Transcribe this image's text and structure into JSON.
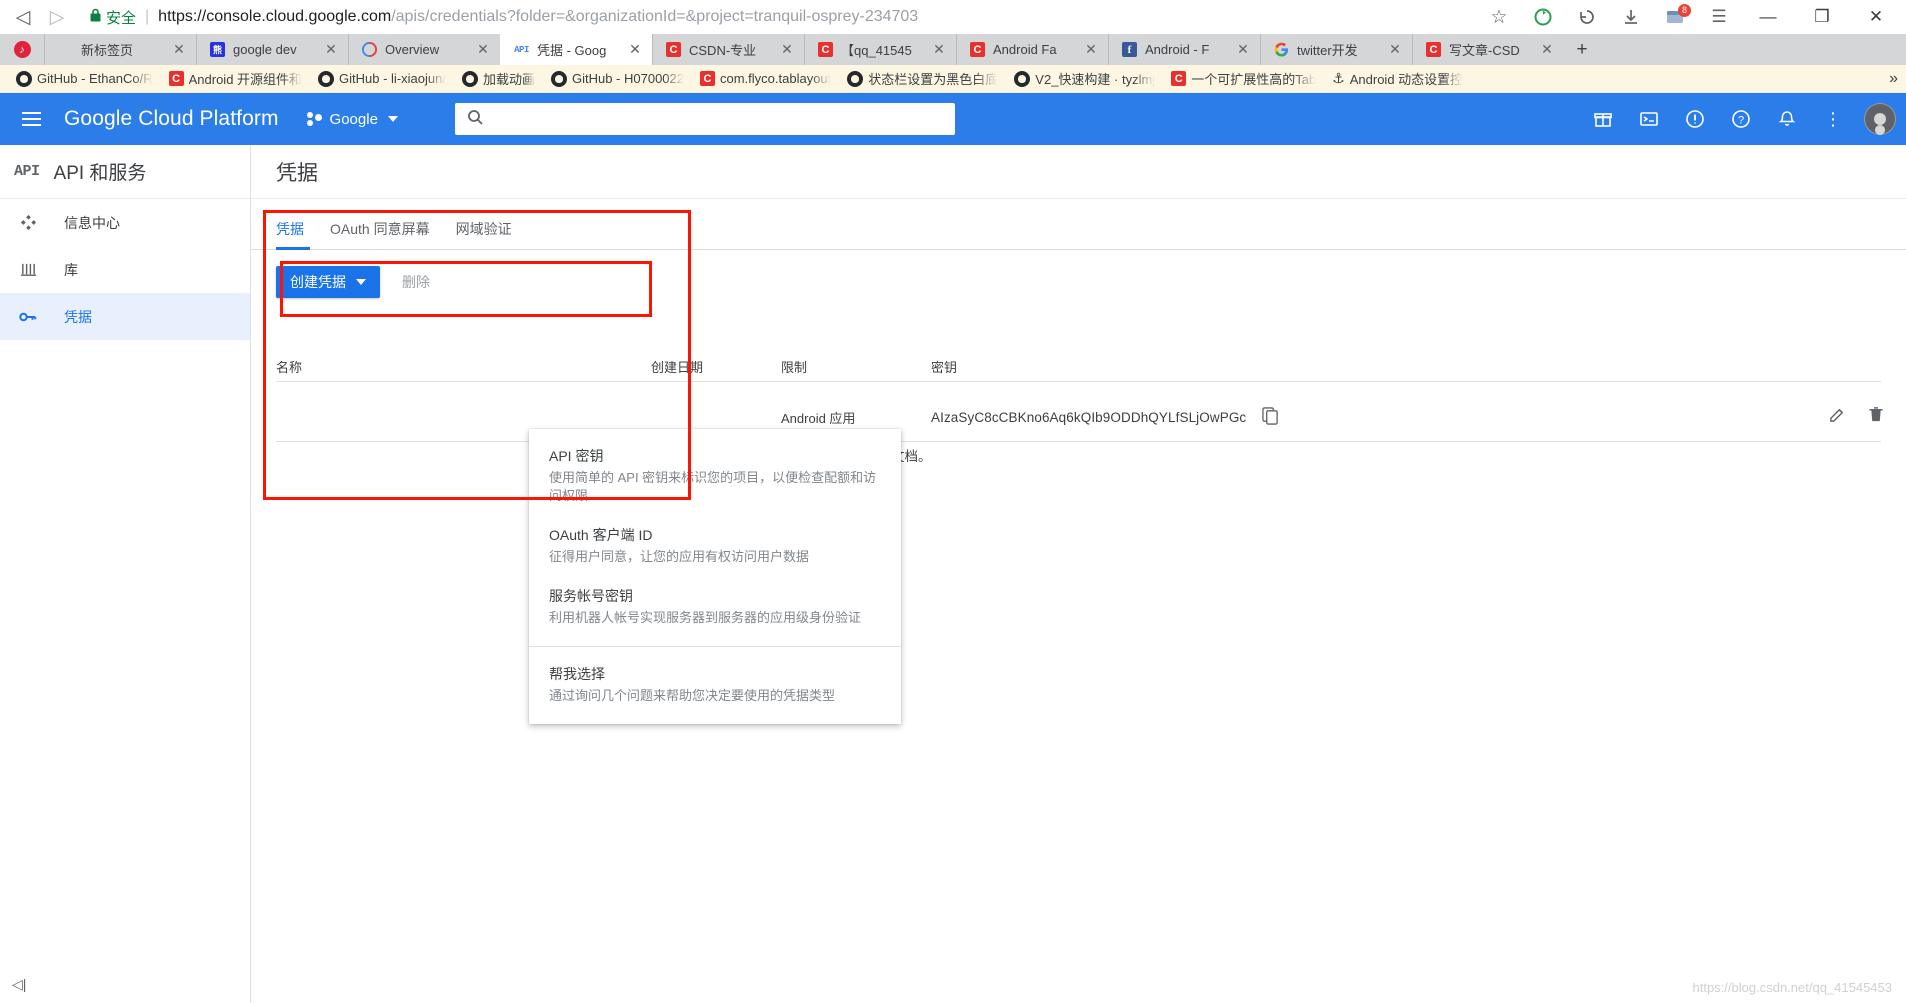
{
  "browser": {
    "nav": {
      "back_icon": "back-arrow-icon",
      "forward_icon": "forward-arrow-icon"
    },
    "security_label": "安全",
    "url_prefix": "https://console.cloud.google.com",
    "url_path": "/apis/credentials?folder=&organizationId=&project=tranquil-osprey-234703",
    "url_full": "https://console.cloud.google.com/apis/credentials?folder=&organizationId=&project=tranquil-osprey-234703",
    "toolbar_icons": [
      {
        "name": "bookmark-star-icon",
        "glyph": "☆"
      },
      {
        "name": "refresh-circle-icon",
        "glyph": "⟳"
      },
      {
        "name": "history-icon",
        "glyph": "⟲"
      },
      {
        "name": "download-icon",
        "glyph": "⭳"
      },
      {
        "name": "extension-icon",
        "glyph": "▤",
        "badge": "8"
      },
      {
        "name": "menu-icon",
        "glyph": "☰"
      }
    ],
    "window_controls": [
      {
        "name": "minimize-button",
        "glyph": "―"
      },
      {
        "name": "restore-button",
        "glyph": "❐"
      },
      {
        "name": "close-button",
        "glyph": "✕"
      }
    ],
    "tabs": [
      {
        "title": "新标签页",
        "favicon": "music-icon",
        "favicon_color": "#e0233c",
        "favicon_text": "♪",
        "active": false,
        "home": false
      },
      {
        "title": "google dev",
        "favicon": "baidu-icon",
        "favicon_color": "#2932e1",
        "favicon_text": "熊",
        "active": false,
        "home": false
      },
      {
        "title": "Overview",
        "favicon": "overview-icon",
        "favicon_color": "#ffffff",
        "favicon_text": "()",
        "active": false,
        "home": false
      },
      {
        "title": "凭据 - Goog",
        "favicon": "api-icon",
        "favicon_color": "#4285f4",
        "favicon_text": "API",
        "active": true,
        "home": false
      },
      {
        "title": "CSDN-专业",
        "favicon": "csdn-icon",
        "favicon_color": "#e8312f",
        "favicon_text": "C",
        "active": false,
        "home": false
      },
      {
        "title": "【qq_41545",
        "favicon": "csdn-icon",
        "favicon_color": "#e8312f",
        "favicon_text": "C",
        "active": false,
        "home": false
      },
      {
        "title": "Android Fa",
        "favicon": "csdn-icon",
        "favicon_color": "#e8312f",
        "favicon_text": "C",
        "active": false,
        "home": false
      },
      {
        "title": "Android - F",
        "favicon": "facebook-icon",
        "favicon_color": "#3b5998",
        "favicon_text": "f",
        "active": false,
        "home": false
      },
      {
        "title": "twitter开发",
        "favicon": "google-icon",
        "favicon_color": "#ffffff",
        "favicon_text": "G",
        "active": false,
        "home": false
      },
      {
        "title": "写文章-CSD",
        "favicon": "csdn-icon",
        "favicon_color": "#e8312f",
        "favicon_text": "C",
        "active": false,
        "home": false
      }
    ],
    "new_tab_label": "+",
    "bookmarks": [
      {
        "label": "GitHub - EthanCo/R",
        "icon": "github-icon"
      },
      {
        "label": "Android 开源组件和",
        "icon": "csdn-icon"
      },
      {
        "label": "GitHub - li-xiaojun/",
        "icon": "github-icon"
      },
      {
        "label": "加载动画",
        "icon": "github-icon"
      },
      {
        "label": "GitHub - H0700022",
        "icon": "github-icon"
      },
      {
        "label": "com.flyco.tablayout",
        "icon": "csdn-icon"
      },
      {
        "label": "状态栏设置为黑色白底",
        "icon": "github-icon"
      },
      {
        "label": "V2_快速构建 · tyzlmj",
        "icon": "github-icon"
      },
      {
        "label": "一个可扩展性高的Tab",
        "icon": "csdn-icon"
      },
      {
        "label": "Android 动态设置控",
        "icon": "anchor-icon"
      }
    ],
    "bookmarks_overflow": "»"
  },
  "gcp": {
    "product_title": "Google Cloud Platform",
    "scope_name": "Google",
    "search_placeholder": "",
    "search_value": "",
    "header_icons": [
      {
        "name": "gifts-icon",
        "glyph": "🎁"
      },
      {
        "name": "cloud-shell-icon",
        "glyph": "⌘"
      },
      {
        "name": "feedback-icon",
        "glyph": "!"
      },
      {
        "name": "help-icon",
        "glyph": "?"
      },
      {
        "name": "notifications-icon",
        "glyph": "🔔"
      },
      {
        "name": "more-vert-icon",
        "glyph": "⋮"
      }
    ],
    "accent_color": "#2b7de9"
  },
  "sidebar": {
    "section_logo": "API",
    "section_title": "API 和服务",
    "items": [
      {
        "label": "信息中心",
        "icon": "dashboard-icon",
        "active": false
      },
      {
        "label": "库",
        "icon": "library-icon",
        "active": false
      },
      {
        "label": "凭据",
        "icon": "key-icon",
        "active": true
      }
    ],
    "collapse_label": "◁|"
  },
  "main": {
    "page_title": "凭据",
    "tabs": [
      {
        "label": "凭据",
        "selected": true
      },
      {
        "label": "OAuth 同意屏幕",
        "selected": false
      },
      {
        "label": "网域验证",
        "selected": false
      }
    ],
    "create_button": "创建凭据",
    "delete_button": "删除",
    "hint_tail": "文档。",
    "table": {
      "headers": [
        "名称",
        "创建日期",
        "限制",
        "密钥"
      ],
      "rows": [
        {
          "name": "",
          "created": "",
          "restriction": "Android 应用",
          "key": "AIzaSyC8cCBKno6Aq6kQIb9ODDhQYLfSLjOwPGc",
          "copy_icon": "copy-icon",
          "edit_icon": "pencil-icon",
          "delete_icon": "trash-icon"
        }
      ]
    },
    "dropdown": {
      "items": [
        {
          "title": "API 密钥",
          "subtitle": "使用简单的 API 密钥来标识您的项目，以便检查配额和访问权限",
          "highlighted": true
        },
        {
          "title": "OAuth 客户端 ID",
          "subtitle": "征得用户同意，让您的应用有权访问用户数据",
          "highlighted": false
        },
        {
          "title": "服务帐号密钥",
          "subtitle": "利用机器人帐号实现服务器到服务器的应用级身份验证",
          "highlighted": false
        },
        {
          "title": "帮我选择",
          "subtitle": "通过询问几个问题来帮助您决定要使用的凭据类型",
          "highlighted": false
        }
      ]
    },
    "annotation_color": "#fc1404"
  },
  "watermark": "https://blog.csdn.net/qq_41545453"
}
